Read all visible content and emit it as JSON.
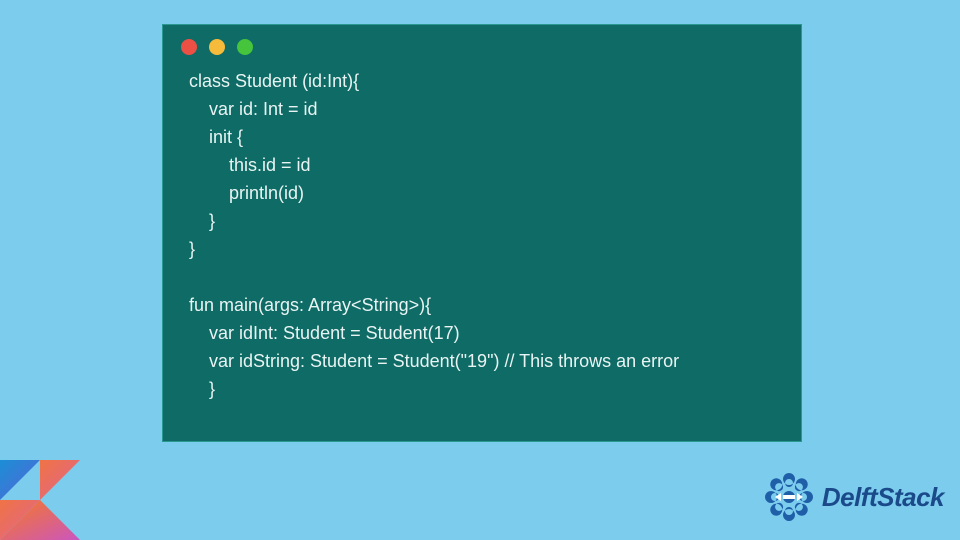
{
  "window": {
    "lights": [
      "red",
      "yellow",
      "green"
    ]
  },
  "code": {
    "lines": [
      "class Student (id:Int){",
      "    var id: Int = id",
      "    init {",
      "        this.id = id",
      "        println(id)",
      "    }",
      "}",
      "",
      "fun main(args: Array<String>){",
      "    var idInt: Student = Student(17)",
      "    var idString: Student = Student(\"19\") // This throws an error",
      "    }"
    ]
  },
  "branding": {
    "name": "DelftStack"
  },
  "colors": {
    "page_bg": "#7cccee",
    "window_bg": "#0f6b65",
    "code_text": "#e8f4f3",
    "brand_text": "#1a4a8a"
  }
}
